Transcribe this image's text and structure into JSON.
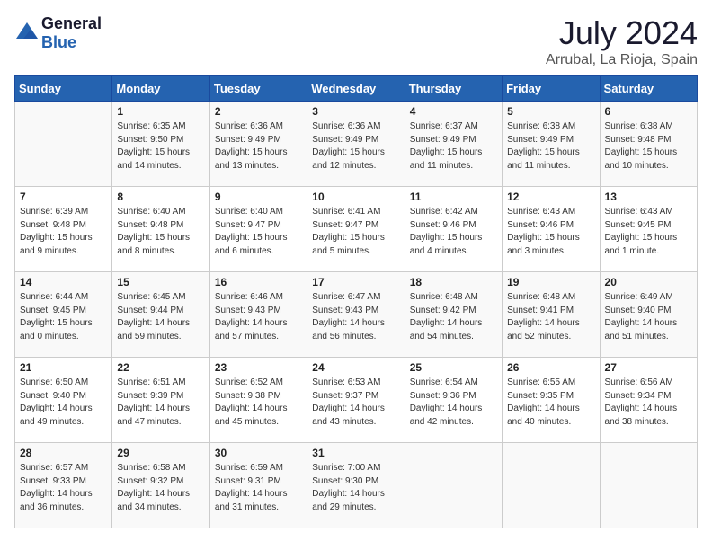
{
  "header": {
    "logo_general": "General",
    "logo_blue": "Blue",
    "month": "July 2024",
    "location": "Arrubal, La Rioja, Spain"
  },
  "days_of_week": [
    "Sunday",
    "Monday",
    "Tuesday",
    "Wednesday",
    "Thursday",
    "Friday",
    "Saturday"
  ],
  "weeks": [
    [
      {
        "day": "",
        "sunrise": "",
        "sunset": "",
        "daylight": ""
      },
      {
        "day": "1",
        "sunrise": "Sunrise: 6:35 AM",
        "sunset": "Sunset: 9:50 PM",
        "daylight": "Daylight: 15 hours and 14 minutes."
      },
      {
        "day": "2",
        "sunrise": "Sunrise: 6:36 AM",
        "sunset": "Sunset: 9:49 PM",
        "daylight": "Daylight: 15 hours and 13 minutes."
      },
      {
        "day": "3",
        "sunrise": "Sunrise: 6:36 AM",
        "sunset": "Sunset: 9:49 PM",
        "daylight": "Daylight: 15 hours and 12 minutes."
      },
      {
        "day": "4",
        "sunrise": "Sunrise: 6:37 AM",
        "sunset": "Sunset: 9:49 PM",
        "daylight": "Daylight: 15 hours and 11 minutes."
      },
      {
        "day": "5",
        "sunrise": "Sunrise: 6:38 AM",
        "sunset": "Sunset: 9:49 PM",
        "daylight": "Daylight: 15 hours and 11 minutes."
      },
      {
        "day": "6",
        "sunrise": "Sunrise: 6:38 AM",
        "sunset": "Sunset: 9:48 PM",
        "daylight": "Daylight: 15 hours and 10 minutes."
      }
    ],
    [
      {
        "day": "7",
        "sunrise": "Sunrise: 6:39 AM",
        "sunset": "Sunset: 9:48 PM",
        "daylight": "Daylight: 15 hours and 9 minutes."
      },
      {
        "day": "8",
        "sunrise": "Sunrise: 6:40 AM",
        "sunset": "Sunset: 9:48 PM",
        "daylight": "Daylight: 15 hours and 8 minutes."
      },
      {
        "day": "9",
        "sunrise": "Sunrise: 6:40 AM",
        "sunset": "Sunset: 9:47 PM",
        "daylight": "Daylight: 15 hours and 6 minutes."
      },
      {
        "day": "10",
        "sunrise": "Sunrise: 6:41 AM",
        "sunset": "Sunset: 9:47 PM",
        "daylight": "Daylight: 15 hours and 5 minutes."
      },
      {
        "day": "11",
        "sunrise": "Sunrise: 6:42 AM",
        "sunset": "Sunset: 9:46 PM",
        "daylight": "Daylight: 15 hours and 4 minutes."
      },
      {
        "day": "12",
        "sunrise": "Sunrise: 6:43 AM",
        "sunset": "Sunset: 9:46 PM",
        "daylight": "Daylight: 15 hours and 3 minutes."
      },
      {
        "day": "13",
        "sunrise": "Sunrise: 6:43 AM",
        "sunset": "Sunset: 9:45 PM",
        "daylight": "Daylight: 15 hours and 1 minute."
      }
    ],
    [
      {
        "day": "14",
        "sunrise": "Sunrise: 6:44 AM",
        "sunset": "Sunset: 9:45 PM",
        "daylight": "Daylight: 15 hours and 0 minutes."
      },
      {
        "day": "15",
        "sunrise": "Sunrise: 6:45 AM",
        "sunset": "Sunset: 9:44 PM",
        "daylight": "Daylight: 14 hours and 59 minutes."
      },
      {
        "day": "16",
        "sunrise": "Sunrise: 6:46 AM",
        "sunset": "Sunset: 9:43 PM",
        "daylight": "Daylight: 14 hours and 57 minutes."
      },
      {
        "day": "17",
        "sunrise": "Sunrise: 6:47 AM",
        "sunset": "Sunset: 9:43 PM",
        "daylight": "Daylight: 14 hours and 56 minutes."
      },
      {
        "day": "18",
        "sunrise": "Sunrise: 6:48 AM",
        "sunset": "Sunset: 9:42 PM",
        "daylight": "Daylight: 14 hours and 54 minutes."
      },
      {
        "day": "19",
        "sunrise": "Sunrise: 6:48 AM",
        "sunset": "Sunset: 9:41 PM",
        "daylight": "Daylight: 14 hours and 52 minutes."
      },
      {
        "day": "20",
        "sunrise": "Sunrise: 6:49 AM",
        "sunset": "Sunset: 9:40 PM",
        "daylight": "Daylight: 14 hours and 51 minutes."
      }
    ],
    [
      {
        "day": "21",
        "sunrise": "Sunrise: 6:50 AM",
        "sunset": "Sunset: 9:40 PM",
        "daylight": "Daylight: 14 hours and 49 minutes."
      },
      {
        "day": "22",
        "sunrise": "Sunrise: 6:51 AM",
        "sunset": "Sunset: 9:39 PM",
        "daylight": "Daylight: 14 hours and 47 minutes."
      },
      {
        "day": "23",
        "sunrise": "Sunrise: 6:52 AM",
        "sunset": "Sunset: 9:38 PM",
        "daylight": "Daylight: 14 hours and 45 minutes."
      },
      {
        "day": "24",
        "sunrise": "Sunrise: 6:53 AM",
        "sunset": "Sunset: 9:37 PM",
        "daylight": "Daylight: 14 hours and 43 minutes."
      },
      {
        "day": "25",
        "sunrise": "Sunrise: 6:54 AM",
        "sunset": "Sunset: 9:36 PM",
        "daylight": "Daylight: 14 hours and 42 minutes."
      },
      {
        "day": "26",
        "sunrise": "Sunrise: 6:55 AM",
        "sunset": "Sunset: 9:35 PM",
        "daylight": "Daylight: 14 hours and 40 minutes."
      },
      {
        "day": "27",
        "sunrise": "Sunrise: 6:56 AM",
        "sunset": "Sunset: 9:34 PM",
        "daylight": "Daylight: 14 hours and 38 minutes."
      }
    ],
    [
      {
        "day": "28",
        "sunrise": "Sunrise: 6:57 AM",
        "sunset": "Sunset: 9:33 PM",
        "daylight": "Daylight: 14 hours and 36 minutes."
      },
      {
        "day": "29",
        "sunrise": "Sunrise: 6:58 AM",
        "sunset": "Sunset: 9:32 PM",
        "daylight": "Daylight: 14 hours and 34 minutes."
      },
      {
        "day": "30",
        "sunrise": "Sunrise: 6:59 AM",
        "sunset": "Sunset: 9:31 PM",
        "daylight": "Daylight: 14 hours and 31 minutes."
      },
      {
        "day": "31",
        "sunrise": "Sunrise: 7:00 AM",
        "sunset": "Sunset: 9:30 PM",
        "daylight": "Daylight: 14 hours and 29 minutes."
      },
      {
        "day": "",
        "sunrise": "",
        "sunset": "",
        "daylight": ""
      },
      {
        "day": "",
        "sunrise": "",
        "sunset": "",
        "daylight": ""
      },
      {
        "day": "",
        "sunrise": "",
        "sunset": "",
        "daylight": ""
      }
    ]
  ]
}
